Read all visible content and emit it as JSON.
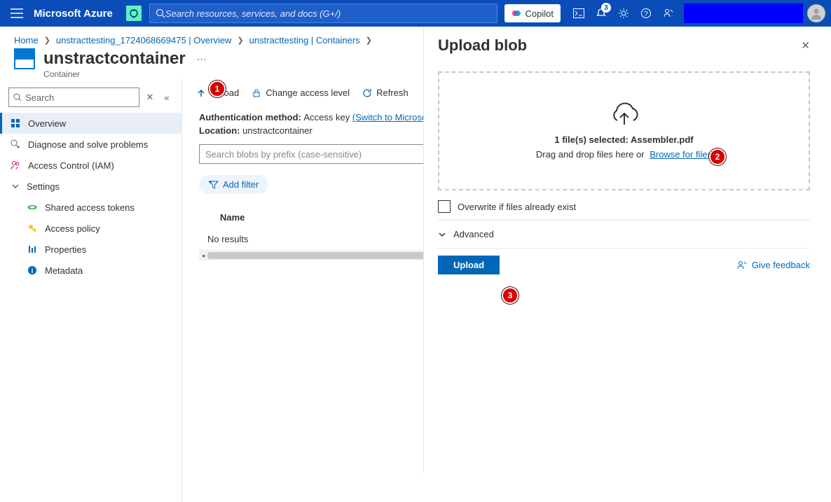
{
  "header": {
    "brand": "Microsoft Azure",
    "search_placeholder": "Search resources, services, and docs (G+/)",
    "copilot": "Copilot",
    "notification_count": "3"
  },
  "breadcrumbs": {
    "item1": "Home",
    "item2": "unstracttesting_1724068669475 | Overview",
    "item3": "unstracttesting | Containers"
  },
  "page_title": {
    "name": "unstractcontainer",
    "type": "Container"
  },
  "sidebar_search": {
    "placeholder": "Search"
  },
  "nav": {
    "overview": "Overview",
    "diagnose": "Diagnose and solve problems",
    "iam": "Access Control (IAM)",
    "settings": "Settings",
    "sas": "Shared access tokens",
    "policy": "Access policy",
    "props": "Properties",
    "meta": "Metadata"
  },
  "toolbar": {
    "upload": "Upload",
    "access": "Change access level",
    "refresh": "Refresh"
  },
  "auth": {
    "label": "Authentication method:",
    "value": "Access key",
    "switch": "(Switch to Microso"
  },
  "location": {
    "label": "Location:",
    "value": "unstractcontainer"
  },
  "blob_search": {
    "placeholder": "Search blobs by prefix (case-sensitive)"
  },
  "filter_btn": "Add filter",
  "table": {
    "col_name": "Name",
    "no_results": "No results"
  },
  "panel": {
    "title": "Upload blob",
    "file_selected": "1 file(s) selected: Assembler.pdf",
    "dz_line": "Drag and drop files here  or",
    "browse": "Browse for files",
    "overwrite": "Overwrite if files already exist",
    "advanced": "Advanced",
    "upload_btn": "Upload",
    "feedback": "Give feedback"
  },
  "annotations": {
    "a1": "1",
    "a2": "2",
    "a3": "3"
  }
}
